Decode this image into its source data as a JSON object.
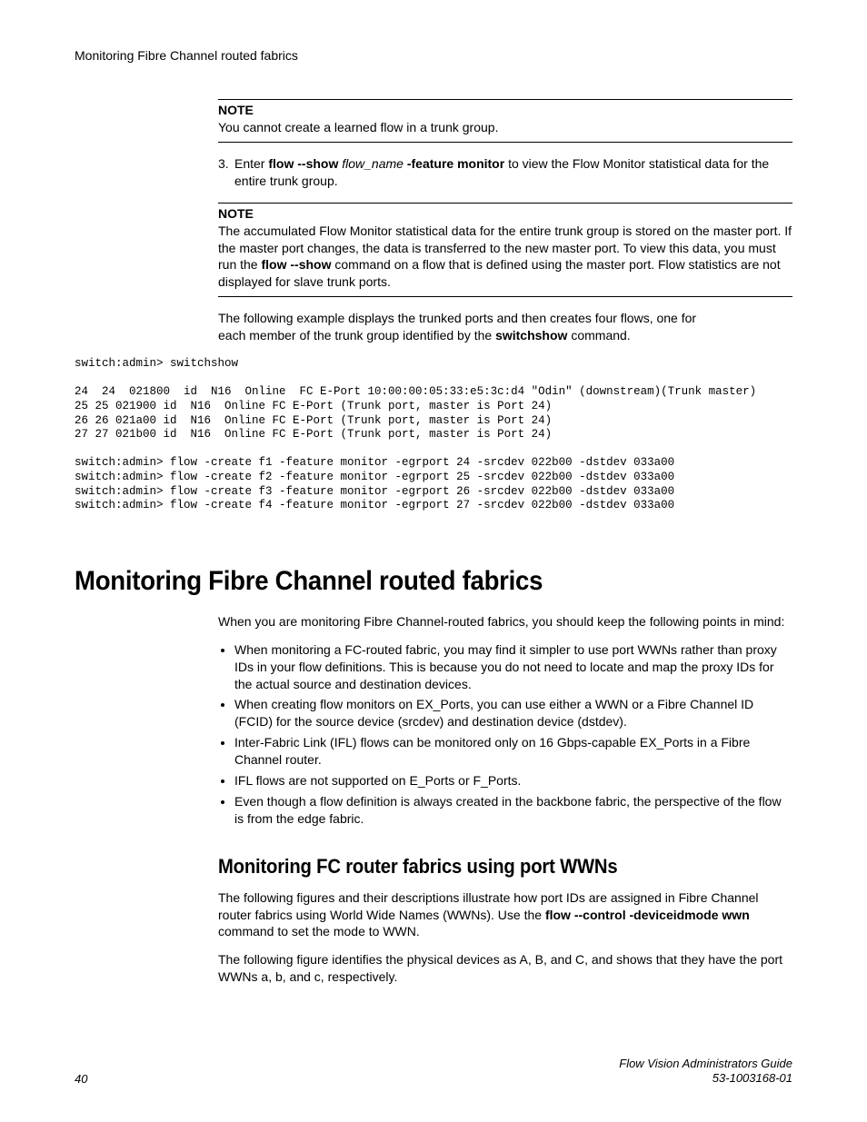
{
  "header": "Monitoring Fibre Channel routed fabrics",
  "note1": {
    "label": "NOTE",
    "body": "You cannot create a learned flow in a trunk group."
  },
  "step3": {
    "num": "3.",
    "pre": "Enter ",
    "cmd1": "flow --show",
    "arg": " flow_name ",
    "cmd2": "-feature monitor",
    "post": " to view the Flow Monitor statistical data for the entire trunk group."
  },
  "note2": {
    "label": "NOTE",
    "body_pre": "The accumulated Flow Monitor statistical data for the entire trunk group is stored on the master port. If the master port changes, the data is transferred to the new master port. To view this data, you must run the ",
    "body_cmd": "flow --show",
    "body_post": " command on a flow that is defined using the master port. Flow statistics are not displayed for slave trunk ports."
  },
  "example_intro": {
    "pre": "The following example displays the trunked ports and then creates four flows, one for each member of the trunk group identified by the ",
    "cmd": "switchshow",
    "post": " command."
  },
  "code": "switch:admin> switchshow\n\n24  24  021800  id  N16  Online  FC E-Port 10:00:00:05:33:e5:3c:d4 \"Odin\" (downstream)(Trunk master)\n25 25 021900 id  N16  Online FC E-Port (Trunk port, master is Port 24)\n26 26 021a00 id  N16  Online FC E-Port (Trunk port, master is Port 24)\n27 27 021b00 id  N16  Online FC E-Port (Trunk port, master is Port 24)\n\nswitch:admin> flow -create f1 -feature monitor -egrport 24 -srcdev 022b00 -dstdev 033a00\nswitch:admin> flow -create f2 -feature monitor -egrport 25 -srcdev 022b00 -dstdev 033a00\nswitch:admin> flow -create f3 -feature monitor -egrport 26 -srcdev 022b00 -dstdev 033a00\nswitch:admin> flow -create f4 -feature monitor -egrport 27 -srcdev 022b00 -dstdev 033a00",
  "h1": "Monitoring Fibre Channel routed fabrics",
  "intro": "When you are monitoring Fibre Channel-routed fabrics, you should keep the following points in mind:",
  "bullets": [
    "When monitoring a FC-routed fabric, you may find it simpler to use port WWNs rather than proxy IDs in your flow definitions. This is because you do not need to locate and map the proxy IDs for the actual source and destination devices.",
    "When creating flow monitors on EX_Ports, you can use either a WWN or a Fibre Channel ID (FCID) for the source device (srcdev) and destination device (dstdev).",
    "Inter-Fabric Link (IFL) flows can be monitored only on 16 Gbps-capable EX_Ports in a Fibre Channel router.",
    "IFL flows are not supported on E_Ports or F_Ports.",
    "Even though a flow definition is always created in the backbone fabric, the perspective of the flow is from the edge fabric."
  ],
  "h2": "Monitoring FC router fabrics using port WWNs",
  "wwn_para1": {
    "pre": "The following figures and their descriptions illustrate how port IDs are assigned in Fibre Channel router fabrics using World Wide Names (WWNs). Use the ",
    "cmd": "flow --control -deviceidmode wwn",
    "post": " command to set the mode to WWN."
  },
  "wwn_para2": "The following figure identifies the physical devices as A, B, and C, and shows that they have the port WWNs a, b, and c, respectively.",
  "footer": {
    "page": "40",
    "guide": "Flow Vision Administrators Guide",
    "docnum": "53-1003168-01"
  }
}
